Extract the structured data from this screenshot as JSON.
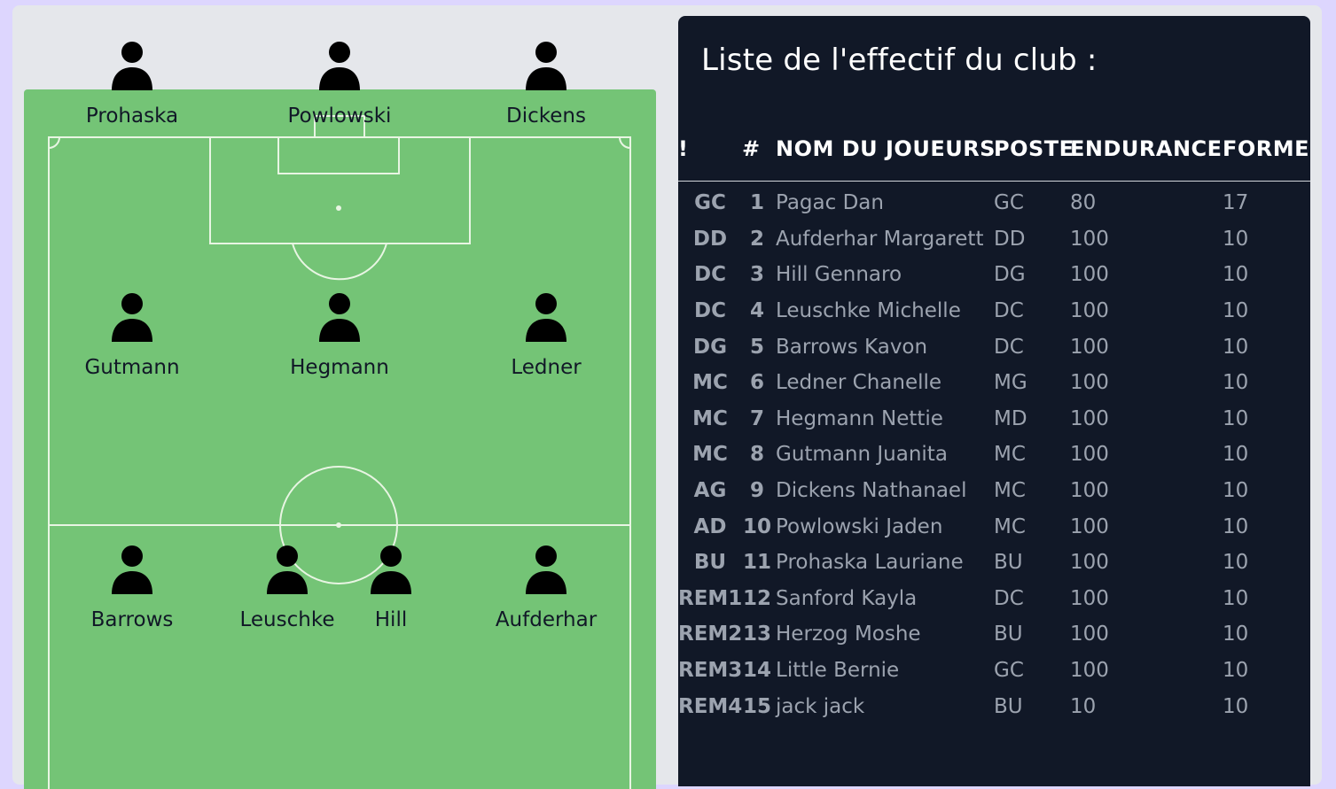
{
  "pitch": {
    "players": [
      {
        "name": "Prohaska"
      },
      {
        "name": "Powlowski"
      },
      {
        "name": "Dickens"
      },
      {
        "name": "Gutmann"
      },
      {
        "name": "Hegmann"
      },
      {
        "name": "Ledner"
      },
      {
        "name": "Barrows"
      },
      {
        "name": "Leuschke"
      },
      {
        "name": "Hill"
      },
      {
        "name": "Aufderhar"
      }
    ],
    "colors": {
      "grass": "#74c476",
      "lines": "#e8f5e3",
      "avatar": "#000000"
    }
  },
  "roster": {
    "title": "Liste de l'effectif du club :",
    "columns": [
      "!",
      "#",
      "NOM DU JOUEURS",
      "POSTE",
      "ENDURANCE",
      "FORME"
    ],
    "rows": [
      {
        "slot": "GC",
        "num": "1",
        "name": "Pagac Dan",
        "poste": "GC",
        "endurance": "80",
        "forme": "17"
      },
      {
        "slot": "DD",
        "num": "2",
        "name": "Aufderhar Margarett",
        "poste": "DD",
        "endurance": "100",
        "forme": "10"
      },
      {
        "slot": "DC",
        "num": "3",
        "name": "Hill Gennaro",
        "poste": "DG",
        "endurance": "100",
        "forme": "10"
      },
      {
        "slot": "DC",
        "num": "4",
        "name": "Leuschke Michelle",
        "poste": "DC",
        "endurance": "100",
        "forme": "10"
      },
      {
        "slot": "DG",
        "num": "5",
        "name": "Barrows Kavon",
        "poste": "DC",
        "endurance": "100",
        "forme": "10"
      },
      {
        "slot": "MC",
        "num": "6",
        "name": "Ledner Chanelle",
        "poste": "MG",
        "endurance": "100",
        "forme": "10"
      },
      {
        "slot": "MC",
        "num": "7",
        "name": "Hegmann Nettie",
        "poste": "MD",
        "endurance": "100",
        "forme": "10"
      },
      {
        "slot": "MC",
        "num": "8",
        "name": "Gutmann Juanita",
        "poste": "MC",
        "endurance": "100",
        "forme": "10"
      },
      {
        "slot": "AG",
        "num": "9",
        "name": "Dickens Nathanael",
        "poste": "MC",
        "endurance": "100",
        "forme": "10"
      },
      {
        "slot": "AD",
        "num": "10",
        "name": "Powlowski Jaden",
        "poste": "MC",
        "endurance": "100",
        "forme": "10"
      },
      {
        "slot": "BU",
        "num": "11",
        "name": "Prohaska Lauriane",
        "poste": "BU",
        "endurance": "100",
        "forme": "10"
      },
      {
        "slot": "REM1",
        "num": "12",
        "name": "Sanford Kayla",
        "poste": "DC",
        "endurance": "100",
        "forme": "10"
      },
      {
        "slot": "REM2",
        "num": "13",
        "name": "Herzog Moshe",
        "poste": "BU",
        "endurance": "100",
        "forme": "10"
      },
      {
        "slot": "REM3",
        "num": "14",
        "name": "Little Bernie",
        "poste": "GC",
        "endurance": "100",
        "forme": "10"
      },
      {
        "slot": "REM4",
        "num": "15",
        "name": "jack jack",
        "poste": "BU",
        "endurance": "10",
        "forme": "10"
      }
    ],
    "colors": {
      "background": "#111827",
      "header": "#ffffff",
      "cell": "#9ca3af"
    }
  }
}
